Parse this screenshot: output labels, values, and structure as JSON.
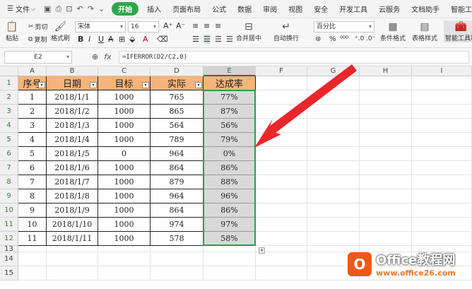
{
  "menu": {
    "file": "文件",
    "tabs": [
      "开始",
      "插入",
      "页面布局",
      "公式",
      "数据",
      "审阅",
      "视图",
      "安全",
      "开发工具",
      "云服务",
      "文档助手",
      "智能工具箱"
    ]
  },
  "ribbon": {
    "paste": "粘贴",
    "cut": "剪切",
    "copy": "复制",
    "format_painter": "格式刷",
    "font_name": "宋体",
    "font_size": "16",
    "merge_center": "合并居中",
    "wrap_text": "自动换行",
    "number_format": "百分比",
    "cond_format": "条件格式",
    "table_style": "表格样式",
    "smart_toolbox": "智能工具箱"
  },
  "formula_bar": {
    "name_box": "E2",
    "fx": "fx",
    "formula": "=IFERROR(D2/C2,0)"
  },
  "sheet": {
    "columns": [
      "A",
      "B",
      "C",
      "D",
      "E",
      "F",
      "G",
      "H",
      "I"
    ],
    "row_numbers": [
      "1",
      "2",
      "3",
      "4",
      "5",
      "6",
      "7",
      "8",
      "9",
      "10",
      "11",
      "12",
      "13",
      "14",
      "15"
    ],
    "headers": [
      "序号",
      "日期",
      "目标",
      "实际",
      "达成率"
    ],
    "rows": [
      [
        "1",
        "2018/1/1",
        "1000",
        "765",
        "77%"
      ],
      [
        "2",
        "2018/1/2",
        "1000",
        "865",
        "87%"
      ],
      [
        "3",
        "2018/1/3",
        "1000",
        "564",
        "56%"
      ],
      [
        "4",
        "2018/1/4",
        "1000",
        "789",
        "79%"
      ],
      [
        "5",
        "2018/1/5",
        "0",
        "964",
        "0%"
      ],
      [
        "6",
        "2018/1/6",
        "1000",
        "864",
        "86%"
      ],
      [
        "7",
        "2018/1/7",
        "1000",
        "879",
        "88%"
      ],
      [
        "8",
        "2018/1/8",
        "1000",
        "964",
        "96%"
      ],
      [
        "9",
        "2018/1/9",
        "1000",
        "864",
        "86%"
      ],
      [
        "10",
        "2018/1/10",
        "1000",
        "974",
        "97%"
      ],
      [
        "11",
        "2018/1/11",
        "1000",
        "578",
        "58%"
      ]
    ]
  },
  "watermark": {
    "brand": "Office教程网",
    "url": "www.office26.com"
  },
  "colors": {
    "accent": "#2ea64b",
    "header_fill": "#f6b47b",
    "selection_fill": "#d9d9d9",
    "arrow": "#e8262c"
  }
}
